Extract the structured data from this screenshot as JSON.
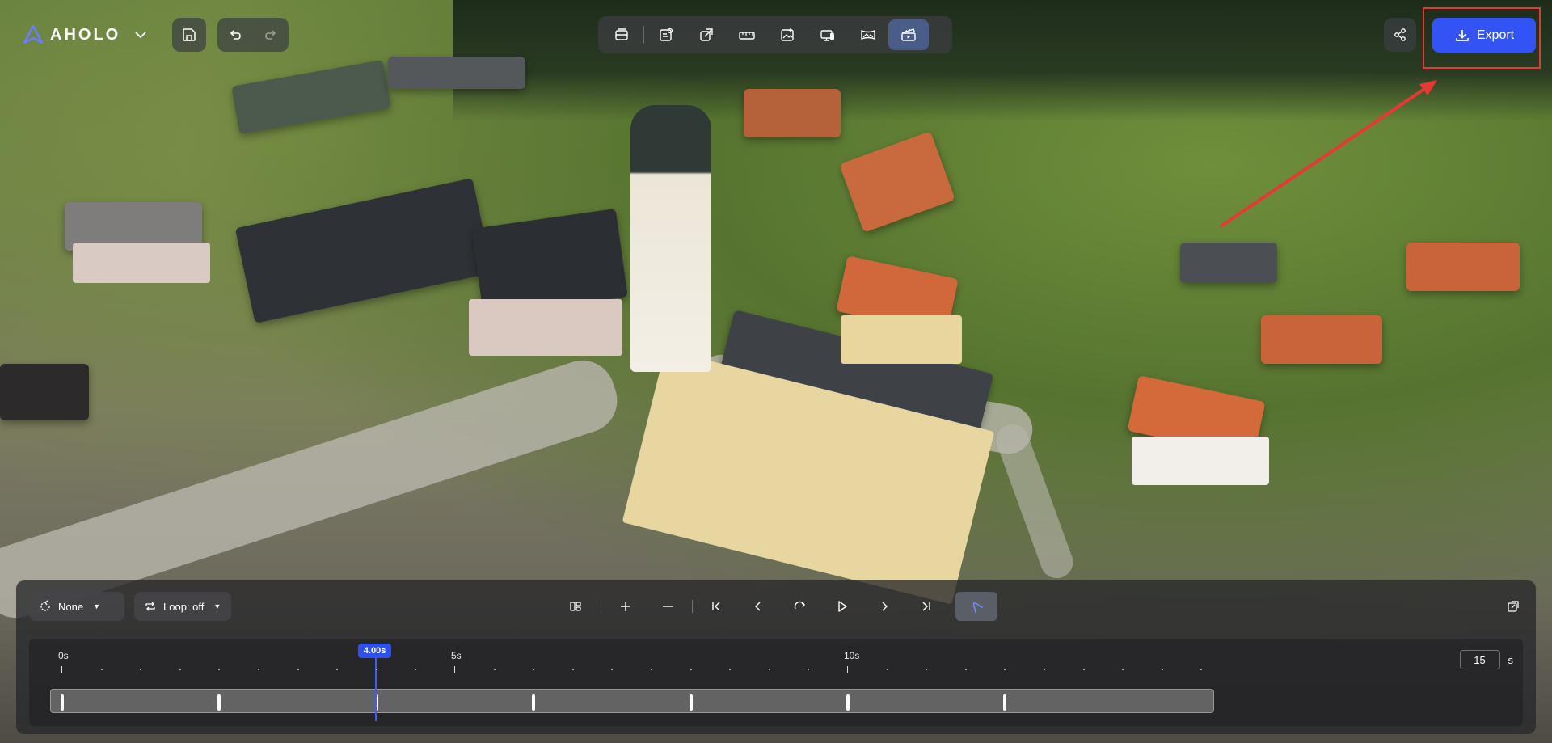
{
  "app": {
    "logo_text": "AHOLO"
  },
  "toolbar": {
    "tools": [
      {
        "icon": "library-icon"
      },
      {
        "icon": "text-edit-icon"
      },
      {
        "icon": "crop-edit-icon"
      },
      {
        "icon": "ruler-icon"
      },
      {
        "icon": "image-add-icon"
      },
      {
        "icon": "screen-display-icon"
      },
      {
        "icon": "panorama-icon"
      },
      {
        "icon": "clapperboard-icon",
        "active": true
      }
    ]
  },
  "export": {
    "label": "Export"
  },
  "panel": {
    "transition_select": {
      "value": "None"
    },
    "loop_select": {
      "value": "Loop: off"
    }
  },
  "timeline": {
    "tick_labels": [
      "0s",
      "5s",
      "10s"
    ],
    "playhead_label": "4.00s",
    "playhead_seconds": 4.0,
    "duration_value": "15",
    "duration_unit": "s",
    "keyframe_seconds": [
      0,
      2,
      4,
      6,
      8,
      10,
      12
    ]
  },
  "colors": {
    "accent": "#3453f5",
    "annotation": "#e53935"
  }
}
